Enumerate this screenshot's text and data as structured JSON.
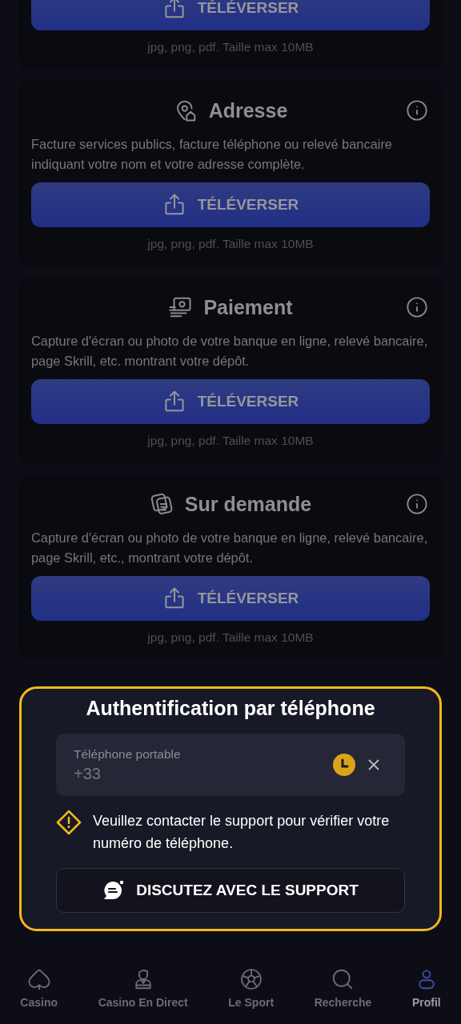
{
  "documents": [
    {
      "kind": "partial",
      "button": "TÉLÉVERSER",
      "note": "jpg, png, pdf. Taille max 10MB"
    },
    {
      "kind": "address",
      "title": "Adresse",
      "description": "Facture services publics, facture téléphone ou relevé bancaire indiquant votre nom et votre adresse complète.",
      "button": "TÉLÉVERSER",
      "note": "jpg, png, pdf. Taille max 10MB"
    },
    {
      "kind": "payment",
      "title": "Paiement",
      "description": "Capture d'écran ou photo de votre banque en ligne, relevé bancaire, page Skrill, etc. montrant votre dépôt.",
      "button": "TÉLÉVERSER",
      "note": "jpg, png, pdf. Taille max 10MB"
    },
    {
      "kind": "request",
      "title": "Sur demande",
      "description": "Capture d'écran ou photo de votre banque en ligne, relevé bancaire, page Skrill, etc., montrant votre dépôt.",
      "button": "TÉLÉVERSER",
      "note": "jpg, png, pdf. Taille max 10MB"
    }
  ],
  "phone_auth": {
    "title": "Authentification par téléphone",
    "field": {
      "label": "Téléphone portable",
      "value": "+33"
    },
    "warning": "Veuillez contacter le support pour vérifier votre numéro de téléphone.",
    "support_button": "DISCUTEZ AVEC LE SUPPORT"
  },
  "nav": [
    {
      "kind": "casino",
      "label": "Casino",
      "selected": false
    },
    {
      "kind": "live",
      "label": "Casino En Direct",
      "selected": false
    },
    {
      "kind": "sport",
      "label": "Le Sport",
      "selected": false
    },
    {
      "kind": "search",
      "label": "Recherche",
      "selected": false
    },
    {
      "kind": "profile",
      "label": "Profil",
      "selected": true
    }
  ]
}
